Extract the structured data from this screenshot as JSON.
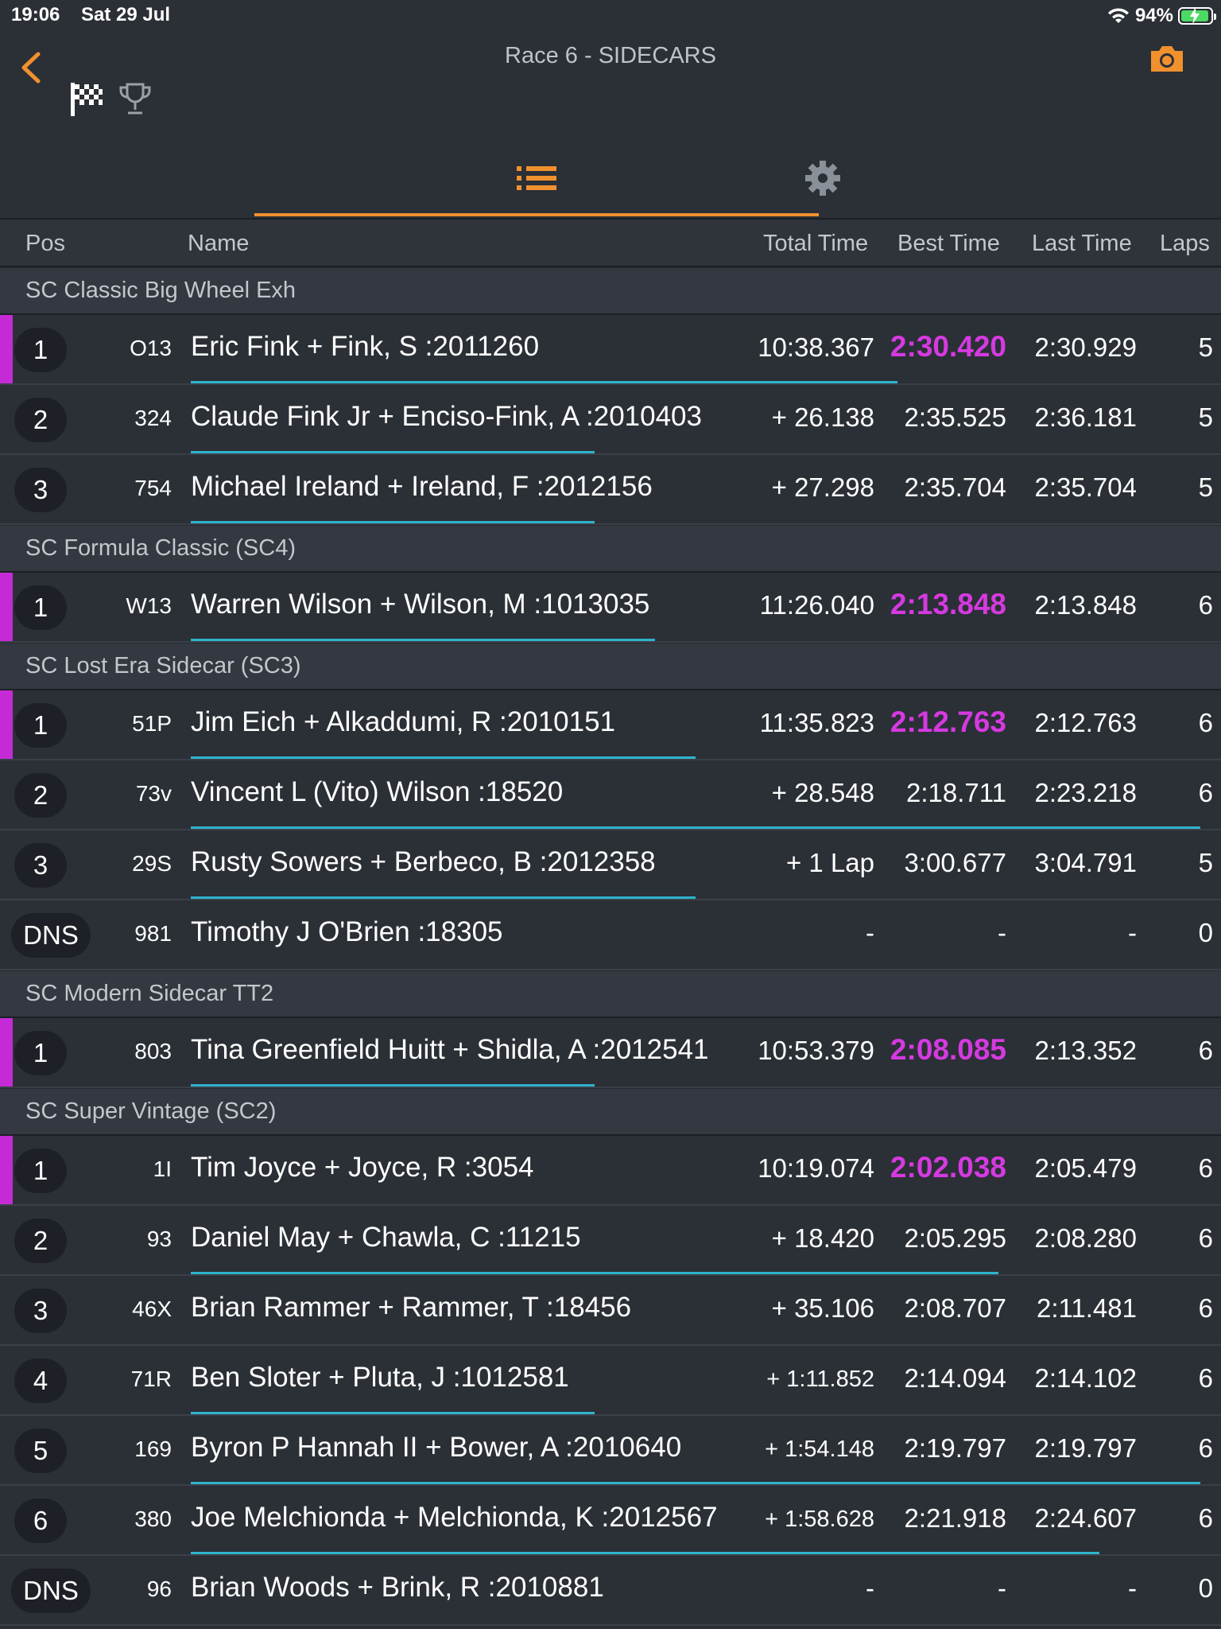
{
  "status": {
    "time": "19:06",
    "date": "Sat 29 Jul",
    "battery": "94%"
  },
  "header": {
    "title": "Race 6 - SIDECARS"
  },
  "columns": {
    "pos": "Pos",
    "name": "Name",
    "total": "Total Time",
    "best": "Best Time",
    "last": "Last Time",
    "laps": "Laps"
  },
  "colors": {
    "accent": "#f0912e",
    "fastest": "#d53ae0",
    "progress": "#2fb4cc",
    "leader": "#c42bd6"
  },
  "sections": [
    {
      "title": "SC Classic Big Wheel Exh",
      "rows": [
        {
          "pos": "1",
          "num": "O13",
          "name": "Eric Fink + Fink, S :2011260",
          "total": "10:38.367",
          "best": "2:30.420",
          "last": "2:30.929",
          "laps": "5",
          "fastest": true,
          "leader": true,
          "progress": 0.7
        },
        {
          "pos": "2",
          "num": "324",
          "name": "Claude Fink Jr + Enciso-Fink, A :2010403",
          "total": "+ 26.138",
          "best": "2:35.525",
          "last": "2:36.181",
          "laps": "5",
          "progress": 0.4
        },
        {
          "pos": "3",
          "num": "754",
          "name": "Michael Ireland + Ireland, F :2012156",
          "total": "+ 27.298",
          "best": "2:35.704",
          "last": "2:35.704",
          "laps": "5",
          "progress": 0.4
        }
      ]
    },
    {
      "title": "SC Formula Classic (SC4)",
      "rows": [
        {
          "pos": "1",
          "num": "W13",
          "name": "Warren Wilson + Wilson, M :1013035",
          "total": "11:26.040",
          "best": "2:13.848",
          "last": "2:13.848",
          "laps": "6",
          "fastest": true,
          "leader": true,
          "progress": 0.46
        }
      ]
    },
    {
      "title": "SC Lost Era Sidecar (SC3)",
      "rows": [
        {
          "pos": "1",
          "num": "51P",
          "name": "Jim Eich + Alkaddumi, R :2010151",
          "total": "11:35.823",
          "best": "2:12.763",
          "last": "2:12.763",
          "laps": "6",
          "fastest": true,
          "leader": true,
          "progress": 0.5
        },
        {
          "pos": "2",
          "num": "73v",
          "name": "Vincent L (Vito) Wilson :18520",
          "total": "+ 28.548",
          "best": "2:18.711",
          "last": "2:23.218",
          "laps": "6",
          "progress": 1.0
        },
        {
          "pos": "3",
          "num": "29S",
          "name": "Rusty Sowers + Berbeco, B :2012358",
          "total": "+ 1 Lap",
          "best": "3:00.677",
          "last": "3:04.791",
          "laps": "5",
          "progress": 0.5
        },
        {
          "pos": "DNS",
          "num": "981",
          "name": "Timothy J O'Brien :18305",
          "total": "-",
          "best": "-",
          "last": "-",
          "laps": "0",
          "progress": 0
        }
      ]
    },
    {
      "title": "SC Modern Sidecar TT2",
      "rows": [
        {
          "pos": "1",
          "num": "803",
          "name": "Tina Greenfield Huitt + Shidla, A :2012541",
          "total": "10:53.379",
          "best": "2:08.085",
          "last": "2:13.352",
          "laps": "6",
          "fastest": true,
          "leader": true,
          "progress": 0.4
        }
      ]
    },
    {
      "title": "SC Super Vintage (SC2)",
      "rows": [
        {
          "pos": "1",
          "num": "1I",
          "name": "Tim Joyce + Joyce, R :3054",
          "total": "10:19.074",
          "best": "2:02.038",
          "last": "2:05.479",
          "laps": "6",
          "fastest": true,
          "leader": true,
          "progress": 0
        },
        {
          "pos": "2",
          "num": "93",
          "name": "Daniel May + Chawla, C :11215",
          "total": "+ 18.420",
          "best": "2:05.295",
          "last": "2:08.280",
          "laps": "6",
          "progress": 0.8
        },
        {
          "pos": "3",
          "num": "46X",
          "name": "Brian Rammer + Rammer, T :18456",
          "total": "+ 35.106",
          "best": "2:08.707",
          "last": "2:11.481",
          "laps": "6",
          "progress": 0
        },
        {
          "pos": "4",
          "num": "71R",
          "name": "Ben Sloter + Pluta, J :1012581",
          "total": "+ 1:11.852",
          "best": "2:14.094",
          "last": "2:14.102",
          "laps": "6",
          "small": true,
          "progress": 0.4
        },
        {
          "pos": "5",
          "num": "169",
          "name": "Byron P Hannah II + Bower, A :2010640",
          "total": "+ 1:54.148",
          "best": "2:19.797",
          "last": "2:19.797",
          "laps": "6",
          "small": true,
          "progress": 1.0
        },
        {
          "pos": "6",
          "num": "380",
          "name": "Joe Melchionda + Melchionda, K :2012567",
          "total": "+ 1:58.628",
          "best": "2:21.918",
          "last": "2:24.607",
          "laps": "6",
          "small": true,
          "progress": 0.9
        },
        {
          "pos": "DNS",
          "num": "96",
          "name": "Brian Woods + Brink, R :2010881",
          "total": "-",
          "best": "-",
          "last": "-",
          "laps": "0",
          "progress": 0
        }
      ]
    }
  ]
}
